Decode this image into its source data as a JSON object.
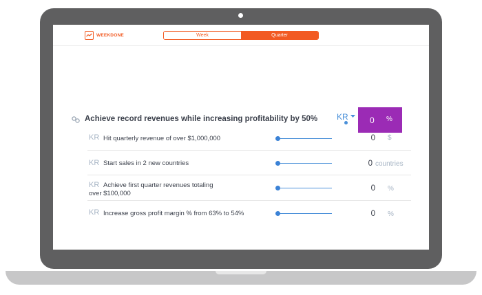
{
  "brand": {
    "name": "WEEKDONE",
    "accent": "#f25a22"
  },
  "period_toggle": {
    "options": [
      "Week",
      "Quarter"
    ],
    "selected": "Quarter"
  },
  "objective": {
    "title": "Achieve record revenues while increasing profitability by 50%",
    "kr_dropdown_label": "KR",
    "score_value": "0",
    "score_unit": "%",
    "score_color": "#9b2bb5"
  },
  "key_results": [
    {
      "tag": "KR",
      "text": "Hit quarterly revenue of over $1,000,000",
      "value": "0",
      "unit": "$",
      "progress": 0
    },
    {
      "tag": "KR",
      "text": "Start sales in 2 new countries",
      "value": "0",
      "unit": "countries",
      "progress": 0
    },
    {
      "tag": "KR",
      "text_line1": "Achieve first quarter revenues totaling",
      "text_line2": "over $100,000",
      "value": "0",
      "unit": "%",
      "progress": 0
    },
    {
      "tag": "KR",
      "text": "Increase gross profit margin % from 63% to 54%",
      "value": "0",
      "unit": "%",
      "progress": 0
    }
  ]
}
